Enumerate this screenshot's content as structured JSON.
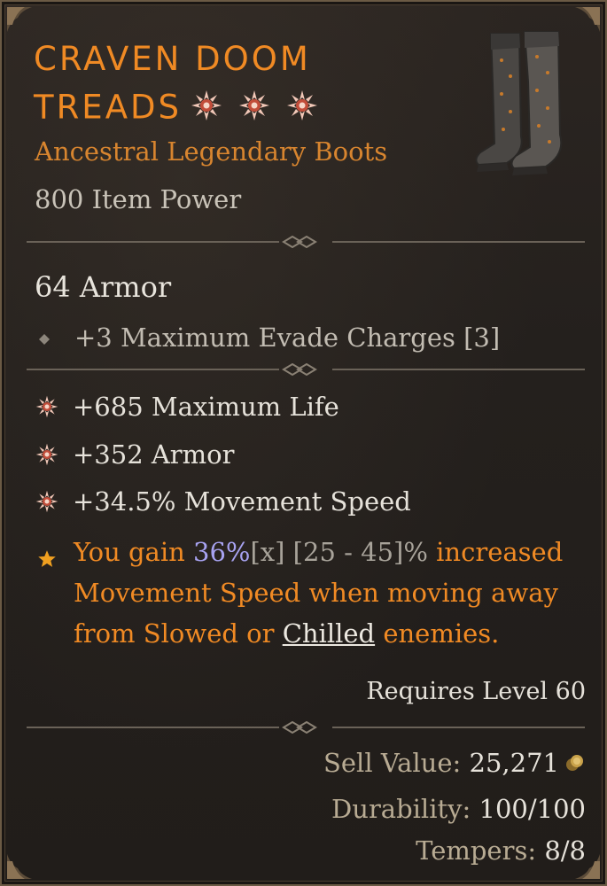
{
  "item": {
    "name_line1": "CRAVEN DOOM",
    "name_line2": "TREADS",
    "subtitle": "Ancestral Legendary Boots",
    "item_power": "800 Item Power",
    "armor": "64 Armor",
    "implicit": "+3 Maximum Evade Charges [3]",
    "affixes": [
      "+685 Maximum Life",
      "+352 Armor",
      "+34.5% Movement Speed"
    ],
    "legendary": {
      "prefix": "You gain ",
      "value": "36%",
      "marker": "[x]",
      "range": " [25 - 45]%",
      "mid": " increased Movement Speed when moving away from Slowed or ",
      "keyword": "Chilled",
      "suffix": " enemies."
    },
    "requirement": "Requires Level 60",
    "sell_label": "Sell Value: ",
    "sell_value": "25,271",
    "durability_label": "Durability: ",
    "durability_value": "100/100",
    "tempers_label": "Tempers: ",
    "tempers_value": "8/8"
  },
  "icons": {
    "title_stars": [
      "greater-affix-icon",
      "greater-affix-icon",
      "greater-affix-icon"
    ],
    "affix_bullet": "greater-affix-icon",
    "legendary_bullet": "legendary-star-icon",
    "implicit_bullet": "diamond-icon",
    "currency": "gold-coin-icon",
    "item_image": "boots-icon"
  },
  "colors": {
    "legendary": "#f08a24",
    "value_highlight": "#a7a2f0",
    "frame": "#6b5a44",
    "background": "#24201d"
  }
}
